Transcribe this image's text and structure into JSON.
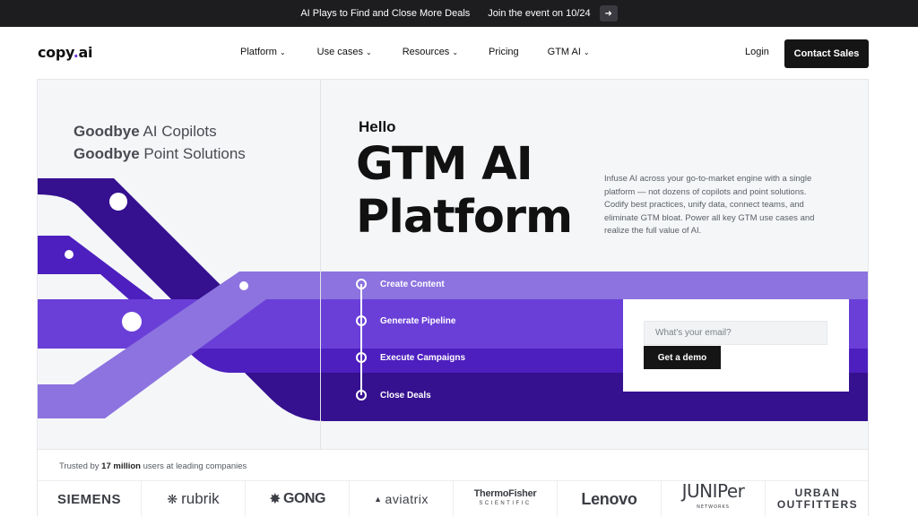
{
  "announcement": {
    "title": "AI Plays to Find and Close More Deals",
    "cta": "Join the event on 10/24",
    "arrow_icon": "arrow-right-icon"
  },
  "nav": {
    "logo_main": "copy",
    "logo_dot": ".",
    "logo_tail": "ai",
    "items": [
      {
        "label": "Platform",
        "has_dropdown": true
      },
      {
        "label": "Use cases",
        "has_dropdown": true
      },
      {
        "label": "Resources",
        "has_dropdown": true
      },
      {
        "label": "Pricing",
        "has_dropdown": false
      },
      {
        "label": "GTM AI",
        "has_dropdown": true
      }
    ],
    "login": "Login",
    "contact": "Contact Sales"
  },
  "hero": {
    "goodbye_1_bold": "Goodbye",
    "goodbye_1_rest": " AI Copilots",
    "goodbye_2_bold": "Goodbye",
    "goodbye_2_rest": " Point Solutions",
    "hello": "Hello",
    "headline_1": "GTM AI",
    "headline_2": "Platform",
    "description": "Infuse AI across your go-to-market engine with a single platform — not dozens of copilots and point solutions. Codify best practices, unify data, connect teams, and eliminate GTM bloat. Power all key GTM use cases and realize the full value of AI.",
    "steps": [
      "Create Content",
      "Generate Pipeline",
      "Execute Campaigns",
      "Close Deals"
    ],
    "email_placeholder": "What's your email?",
    "demo_button": "Get a demo"
  },
  "colors": {
    "lavender": "#8c73df",
    "violet": "#6a3fd8",
    "purple": "#4d1fbf",
    "indigo": "#35108f"
  },
  "trusted": {
    "prefix": "Trusted by ",
    "count": "17 million",
    "suffix": " users at leading companies",
    "logos": {
      "siemens": "SIEMENS",
      "rubrik": "rubrik",
      "gong": "GONG",
      "aviatrix": "aviatrix",
      "thermo_main": "ThermoFisher",
      "thermo_sub": "SCIENTIFIC",
      "lenovo": "Lenovo",
      "juniper_main": "JUNIPer",
      "juniper_sub": "NETWORKS",
      "urban_1": "URBAN",
      "urban_2": "OUTFITTERS"
    }
  }
}
